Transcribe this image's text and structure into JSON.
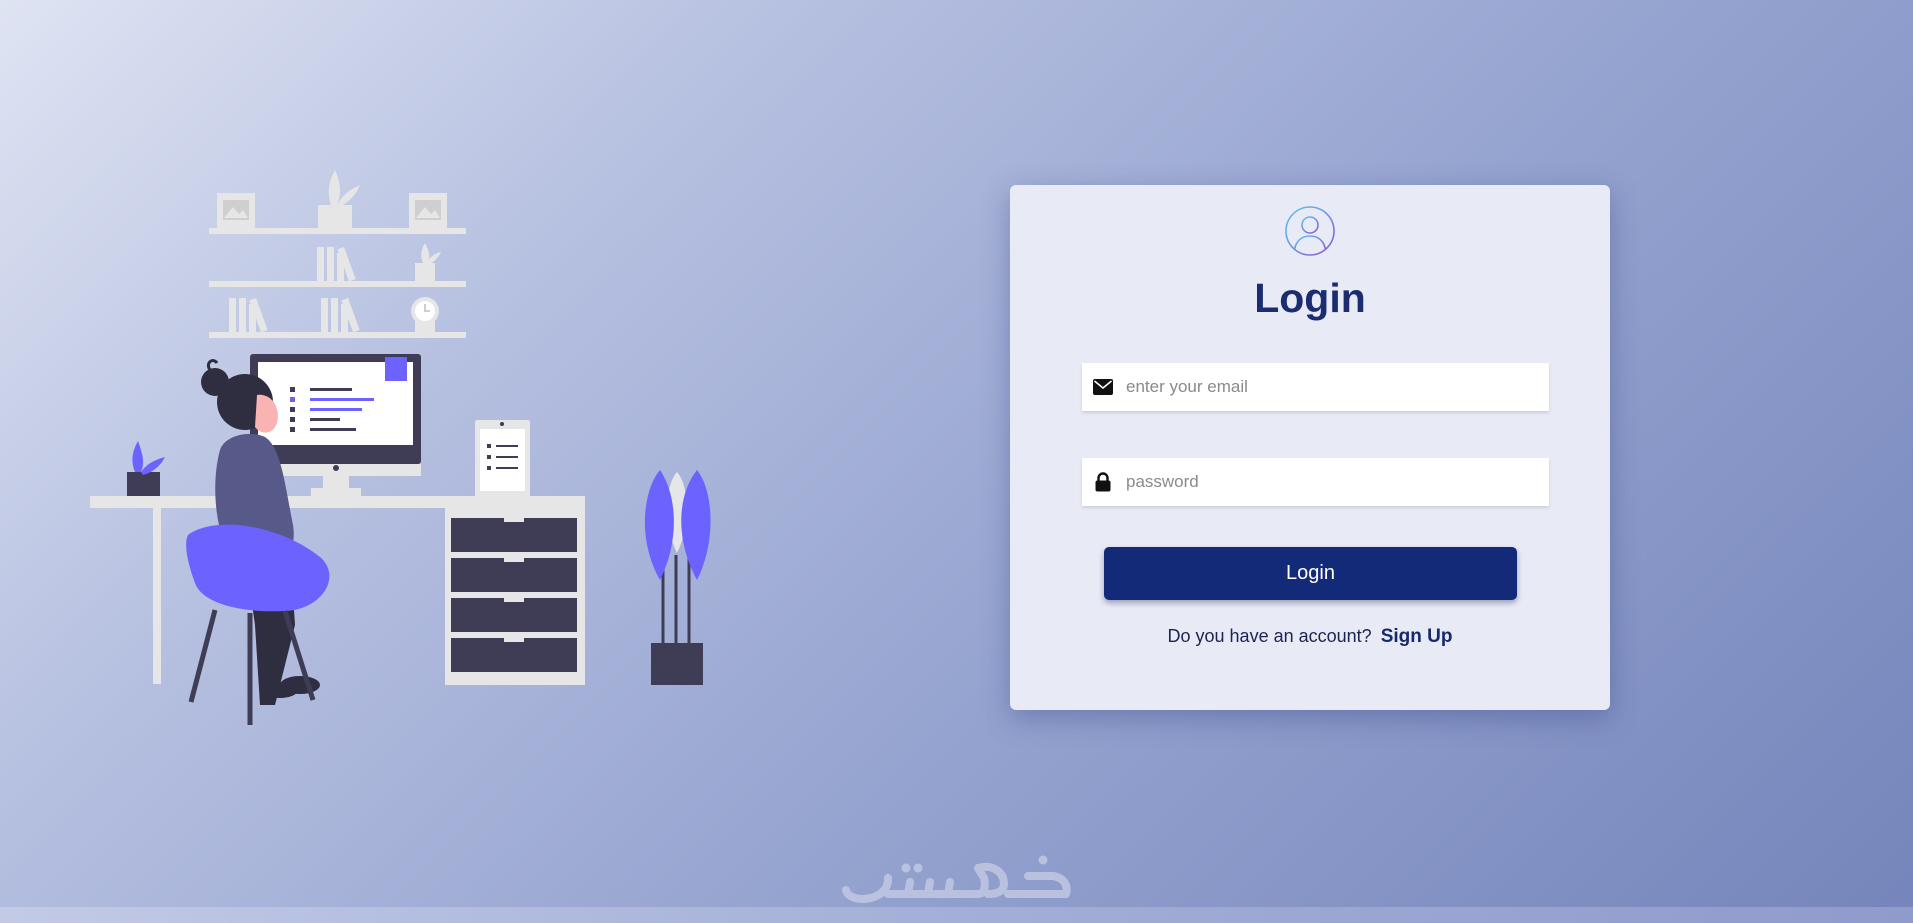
{
  "login_card": {
    "title": "Login",
    "email": {
      "placeholder": "enter your email",
      "value": ""
    },
    "password": {
      "placeholder": "password",
      "value": ""
    },
    "submit_label": "Login",
    "account_prompt": "Do you have an account?",
    "signup_label": "Sign Up"
  },
  "icons": {
    "avatar": "user-circle-icon",
    "email": "envelope-icon",
    "password": "lock-icon"
  },
  "colors": {
    "brand_navy": "#132a78",
    "title": "#1b2c70",
    "card_bg": "#e8eaf6",
    "accent_purple": "#6c63ff"
  }
}
